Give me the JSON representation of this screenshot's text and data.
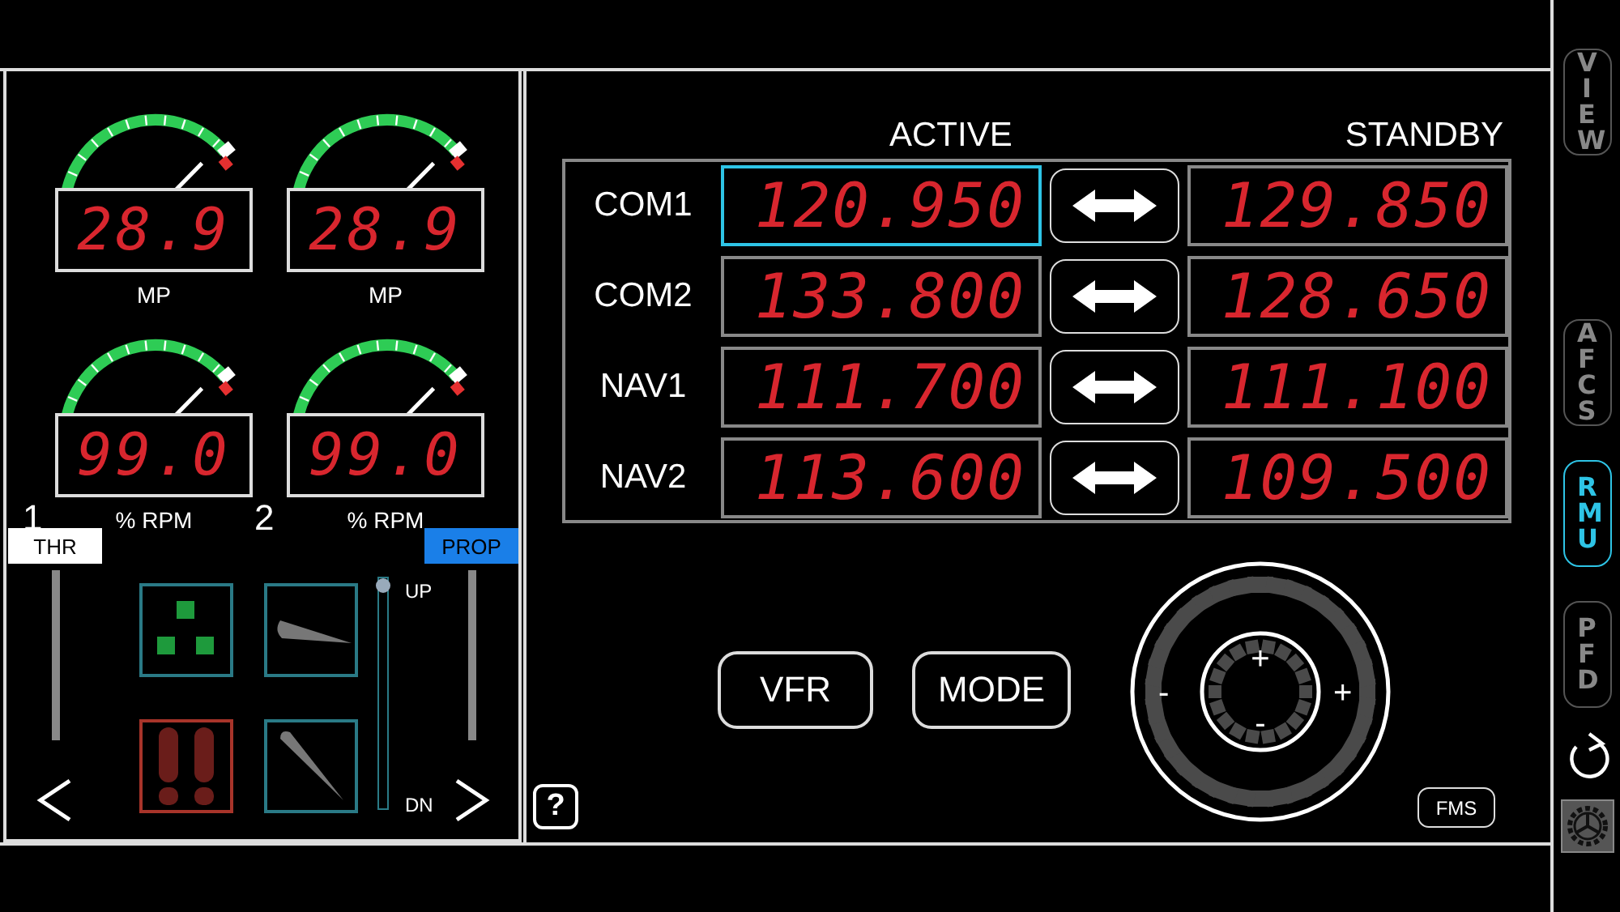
{
  "gauges": [
    {
      "reading": "28.9",
      "label": "MP"
    },
    {
      "reading": "28.9",
      "label": "MP"
    },
    {
      "reading": "99.0",
      "label": "% RPM",
      "engine": "1"
    },
    {
      "reading": "99.0",
      "label": "% RPM",
      "engine": "2"
    }
  ],
  "levers": [
    {
      "label": "THR",
      "selected": false
    },
    {
      "label": "PROP",
      "selected": true
    }
  ],
  "indicators": [
    {
      "kind": "gear",
      "on": false
    },
    {
      "kind": "spoiler",
      "on": false
    },
    {
      "kind": "brakes",
      "on": true
    },
    {
      "kind": "flap",
      "on": false
    }
  ],
  "flaps": {
    "up_label": "UP",
    "down_label": "DN",
    "level": 1
  },
  "radio": {
    "active_header": "ACTIVE",
    "standby_header": "STANDBY",
    "rows": [
      {
        "name": "COM1",
        "active": "120.950",
        "standby": "129.850",
        "selected": true
      },
      {
        "name": "COM2",
        "active": "133.800",
        "standby": "128.650",
        "selected": false
      },
      {
        "name": "NAV1",
        "active": "111.700",
        "standby": "111.100",
        "selected": false
      },
      {
        "name": "NAV2",
        "active": "113.600",
        "standby": "109.500",
        "selected": false
      }
    ]
  },
  "buttons": [
    "VFR",
    "MODE"
  ],
  "knob": {
    "outer_minus": "-",
    "outer_plus": "+",
    "inner_plus": "+",
    "inner_minus": "-"
  },
  "help": "?",
  "fms": "FMS",
  "sidebar": [
    {
      "label": "VIEW",
      "selected": false
    },
    {
      "label": "AFCS",
      "selected": false
    },
    {
      "label": "RMU",
      "selected": true
    },
    {
      "label": "PFD",
      "selected": false
    }
  ]
}
